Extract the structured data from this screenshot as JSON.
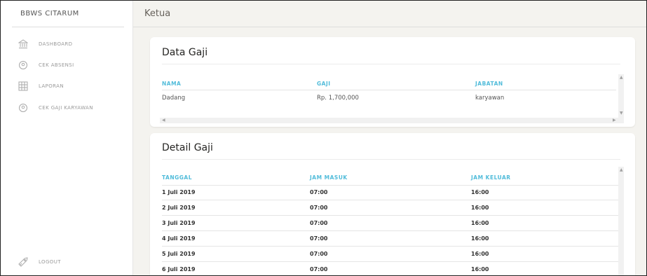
{
  "sidebar": {
    "brand": "BBWS CITARUM",
    "items": [
      {
        "label": "DASHBOARD",
        "icon": "bank-icon"
      },
      {
        "label": "CEK ABSENSI",
        "icon": "map-pin-icon"
      },
      {
        "label": "LAPORAN",
        "icon": "grid-icon"
      },
      {
        "label": "CEK GAJI KARYAWAN",
        "icon": "map-pin-icon"
      }
    ],
    "logout": {
      "label": "LOGOUT",
      "icon": "rocket-icon"
    }
  },
  "header": {
    "title": "Ketua"
  },
  "data_gaji": {
    "title": "Data Gaji",
    "columns": [
      "NAMA",
      "GAJI",
      "JABATAN"
    ],
    "rows": [
      [
        "Dadang",
        "Rp. 1,700,000",
        "karyawan"
      ]
    ]
  },
  "detail_gaji": {
    "title": "Detail Gaji",
    "columns": [
      "TANGGAL",
      "JAM MASUK",
      "JAM KELUAR"
    ],
    "rows": [
      [
        "1 Juli 2019",
        "07:00",
        "16:00"
      ],
      [
        "2 Juli 2019",
        "07:00",
        "16:00"
      ],
      [
        "3 Juli 2019",
        "07:00",
        "16:00"
      ],
      [
        "4 Juli 2019",
        "07:00",
        "16:00"
      ],
      [
        "5 Juli 2019",
        "07:00",
        "16:00"
      ],
      [
        "6 Juli 2019",
        "07:00",
        "16:00"
      ]
    ]
  },
  "colors": {
    "accent": "#51bcda",
    "background": "#f4f3ef",
    "sidebar": "#ffffff"
  }
}
